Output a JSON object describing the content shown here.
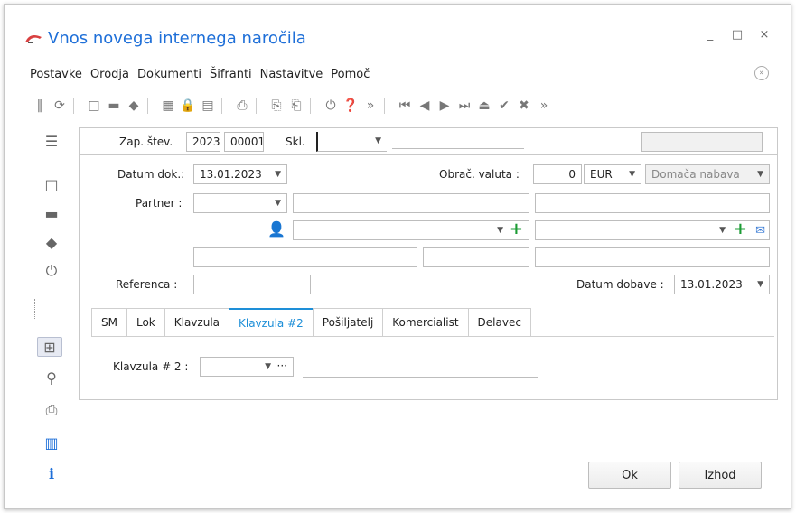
{
  "window": {
    "title": "Vnos novega internega naročila",
    "minimize": "_",
    "maximize": "□",
    "close": "×"
  },
  "menu": [
    "Postavke",
    "Orodja",
    "Dokumenti",
    "Šifranti",
    "Nastavitve",
    "Pomoč"
  ],
  "header": {
    "zap_label": "Zap. štev.",
    "year": "2023",
    "number": "00001",
    "skl_label": "Skl.",
    "skl_value": ""
  },
  "form": {
    "datum_dok_label": "Datum dok.:",
    "datum_dok_value": "13.01.2023",
    "obrac_valuta_label": "Obrač. valuta :",
    "obrac_valuta_amount": "0",
    "currency": "EUR",
    "nabava": "Domača nabava",
    "partner_label": "Partner :",
    "referenca_label": "Referenca :",
    "datum_dobave_label": "Datum dobave :",
    "datum_dobave_value": "13.01.2023"
  },
  "tabs": [
    "SM",
    "Lok",
    "Klavzula",
    "Klavzula #2",
    "Pošiljatelj",
    "Komercialist",
    "Delavec"
  ],
  "active_tab": "Klavzula #2",
  "tab_content": {
    "klavzula2_label": "Klavzula # 2 :"
  },
  "buttons": {
    "ok": "Ok",
    "izhod": "Izhod"
  },
  "colors": {
    "title_blue": "#1e6fd8",
    "tab_active": "#1e8fd8",
    "plus_green": "#1b9b34",
    "gold": "#e7a400"
  }
}
